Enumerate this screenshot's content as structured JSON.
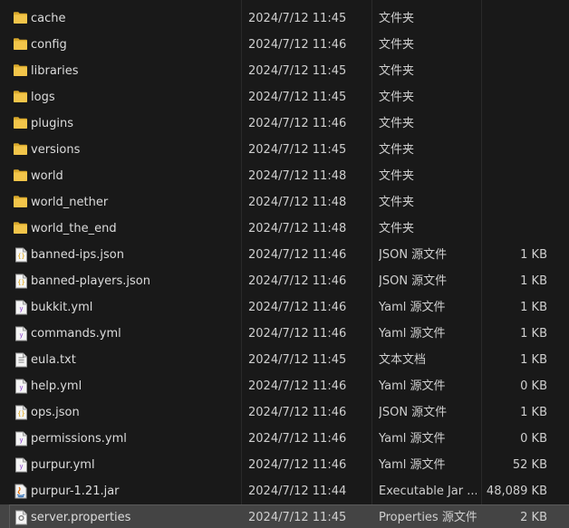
{
  "files": [
    {
      "name": "cache",
      "date": "2024/7/12 11:45",
      "type": "文件夹",
      "size": "",
      "icon": "folder-icon"
    },
    {
      "name": "config",
      "date": "2024/7/12 11:46",
      "type": "文件夹",
      "size": "",
      "icon": "folder-icon"
    },
    {
      "name": "libraries",
      "date": "2024/7/12 11:45",
      "type": "文件夹",
      "size": "",
      "icon": "folder-icon"
    },
    {
      "name": "logs",
      "date": "2024/7/12 11:45",
      "type": "文件夹",
      "size": "",
      "icon": "folder-icon"
    },
    {
      "name": "plugins",
      "date": "2024/7/12 11:46",
      "type": "文件夹",
      "size": "",
      "icon": "folder-icon"
    },
    {
      "name": "versions",
      "date": "2024/7/12 11:45",
      "type": "文件夹",
      "size": "",
      "icon": "folder-icon"
    },
    {
      "name": "world",
      "date": "2024/7/12 11:48",
      "type": "文件夹",
      "size": "",
      "icon": "folder-icon"
    },
    {
      "name": "world_nether",
      "date": "2024/7/12 11:48",
      "type": "文件夹",
      "size": "",
      "icon": "folder-icon"
    },
    {
      "name": "world_the_end",
      "date": "2024/7/12 11:48",
      "type": "文件夹",
      "size": "",
      "icon": "folder-icon"
    },
    {
      "name": "banned-ips.json",
      "date": "2024/7/12 11:46",
      "type": "JSON 源文件",
      "size": "1 KB",
      "icon": "json-file-icon"
    },
    {
      "name": "banned-players.json",
      "date": "2024/7/12 11:46",
      "type": "JSON 源文件",
      "size": "1 KB",
      "icon": "json-file-icon"
    },
    {
      "name": "bukkit.yml",
      "date": "2024/7/12 11:46",
      "type": "Yaml 源文件",
      "size": "1 KB",
      "icon": "yaml-file-icon"
    },
    {
      "name": "commands.yml",
      "date": "2024/7/12 11:46",
      "type": "Yaml 源文件",
      "size": "1 KB",
      "icon": "yaml-file-icon"
    },
    {
      "name": "eula.txt",
      "date": "2024/7/12 11:45",
      "type": "文本文档",
      "size": "1 KB",
      "icon": "text-file-icon"
    },
    {
      "name": "help.yml",
      "date": "2024/7/12 11:46",
      "type": "Yaml 源文件",
      "size": "0 KB",
      "icon": "yaml-file-icon"
    },
    {
      "name": "ops.json",
      "date": "2024/7/12 11:46",
      "type": "JSON 源文件",
      "size": "1 KB",
      "icon": "json-file-icon"
    },
    {
      "name": "permissions.yml",
      "date": "2024/7/12 11:46",
      "type": "Yaml 源文件",
      "size": "0 KB",
      "icon": "yaml-file-icon"
    },
    {
      "name": "purpur.yml",
      "date": "2024/7/12 11:46",
      "type": "Yaml 源文件",
      "size": "52 KB",
      "icon": "yaml-file-icon"
    },
    {
      "name": "purpur-1.21.jar",
      "date": "2024/7/12 11:44",
      "type": "Executable Jar ...",
      "size": "48,089 KB",
      "icon": "java-jar-icon"
    },
    {
      "name": "server.properties",
      "date": "2024/7/12 11:45",
      "type": "Properties 源文件",
      "size": "2 KB",
      "icon": "properties-file-icon",
      "selected": true
    }
  ],
  "colors": {
    "background": "#191919",
    "text": "#dcdcdc",
    "folder": "#f2c54a",
    "selection": "#444444"
  }
}
